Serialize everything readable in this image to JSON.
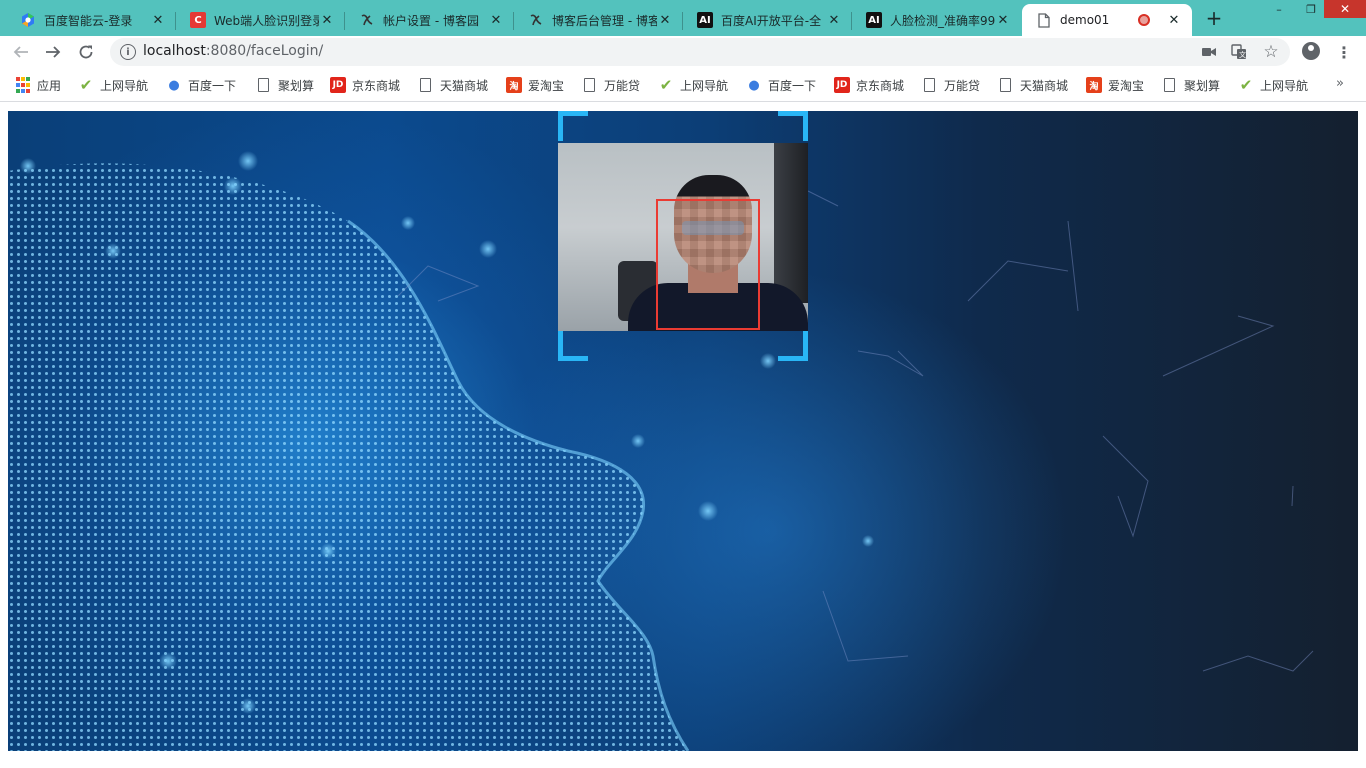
{
  "browser": {
    "tabs": [
      {
        "title": "百度智能云-登录",
        "favicon": "baidu-cloud-icon",
        "color": "#2f7bf5",
        "active": false
      },
      {
        "title": "Web端人脸识别登录",
        "favicon": "csdn-icon",
        "color": "#e53935",
        "active": false
      },
      {
        "title": "帐户设置 - 博客园",
        "favicon": "cnblogs-icon",
        "color": "#333333",
        "active": false
      },
      {
        "title": "博客后台管理 - 博客",
        "favicon": "cnblogs-icon",
        "color": "#333333",
        "active": false
      },
      {
        "title": "百度AI开放平台-全",
        "favicon": "ai-icon",
        "color": "#111111",
        "active": false
      },
      {
        "title": "人脸检测_准确率99",
        "favicon": "ai-icon",
        "color": "#111111",
        "active": false
      },
      {
        "title": "demo01",
        "favicon": "page-icon",
        "color": "#5f6368",
        "active": true
      }
    ],
    "new_tab_symbol": "+",
    "window_controls": {
      "minimize": "–",
      "restore": "❐",
      "close": "✕"
    },
    "url_host": "localhost",
    "url_rest": ":8080/faceLogin/",
    "bookmarks": [
      {
        "label": "应用",
        "icon": "apps-icon"
      },
      {
        "label": "上网导航",
        "icon": "hao123-icon"
      },
      {
        "label": "百度一下",
        "icon": "baidu-paw-icon"
      },
      {
        "label": "聚划算",
        "icon": "page-icon"
      },
      {
        "label": "京东商城",
        "icon": "jd-icon"
      },
      {
        "label": "天猫商城",
        "icon": "page-icon"
      },
      {
        "label": "爱淘宝",
        "icon": "taobao-icon"
      },
      {
        "label": "万能贷",
        "icon": "page-icon"
      },
      {
        "label": "上网导航",
        "icon": "hao123-icon"
      },
      {
        "label": "百度一下",
        "icon": "baidu-paw-icon"
      },
      {
        "label": "京东商城",
        "icon": "jd-icon"
      },
      {
        "label": "万能贷",
        "icon": "page-icon"
      },
      {
        "label": "天猫商城",
        "icon": "page-icon"
      },
      {
        "label": "爱淘宝",
        "icon": "taobao-icon"
      },
      {
        "label": "聚划算",
        "icon": "page-icon"
      },
      {
        "label": "上网导航",
        "icon": "hao123-icon"
      }
    ],
    "bookmarks_more": "»"
  },
  "page": {
    "camera_view": {
      "face_detected": true,
      "frame_color": "#29b6f6",
      "face_box_color": "#ea3b33"
    },
    "background": "ai-face-particle-background"
  },
  "colors": {
    "tabstrip": "#53c2bd",
    "accent": "#29b6f6",
    "face_box": "#ea3b33"
  }
}
